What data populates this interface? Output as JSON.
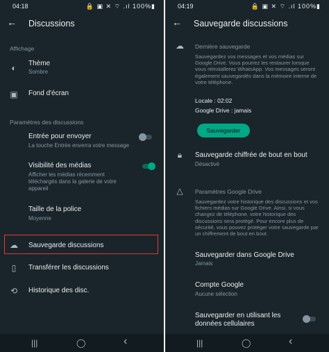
{
  "left": {
    "status": {
      "time": "04:18",
      "icons": "🔒 ▣ ✕ ⌔ .ıl 100%▮"
    },
    "title": "Discussions",
    "sections": {
      "display_head": "Affichage",
      "params_head": "Paramètres des discussions"
    },
    "items": {
      "theme": {
        "title": "Thème",
        "sub": "Sombre"
      },
      "wallpaper": {
        "title": "Fond d'écran"
      },
      "enter": {
        "title": "Entrée pour envoyer",
        "sub": "La touche Entrée enverra votre message",
        "toggle": "off"
      },
      "media": {
        "title": "Visibilité des médias",
        "sub": "Afficher les médias récemment téléchargés dans la galerie de votre appareil",
        "toggle": "on"
      },
      "font": {
        "title": "Taille de la police",
        "sub": "Moyenne"
      },
      "backup": {
        "title": "Sauvegarde discussions"
      },
      "transfer": {
        "title": "Transférer les discussions"
      },
      "history": {
        "title": "Historique des disc."
      }
    }
  },
  "right": {
    "status": {
      "time": "04:19",
      "icons": "🔒 ▣ ✕ ⌔ .ıl 100%▮"
    },
    "title": "Sauvegarde discussions",
    "last_backup": {
      "head": "Dernière sauvegarde",
      "body": "Sauvegardez vos messages et vos médias sur Google Drive. Vous pourrez les restaurer lorsque vous réinstallerez WhatsApp. Vos messages seront également sauvegardés dans la mémoire interne de votre téléphone.",
      "local": "Locale : 02:02",
      "drive": "Google Drive : jamais",
      "button": "Sauvegarder"
    },
    "encrypted": {
      "title": "Sauvegarde chiffrée de bout en bout",
      "sub": "Désactivé"
    },
    "gdrive": {
      "head": "Paramètres Google Drive",
      "body": "Sauvegardez votre historique des discussions et vos fichiers médias sur Google Drive. Ainsi, si vous changez de téléphone, votre historique des discussions sera protégé. Pour encore plus de sécurité, vous pouvez protéger votre sauvegarde par un chiffrement de bout en bout."
    },
    "save_drive": {
      "title": "Sauvegarder dans Google Drive",
      "sub": "Jamais"
    },
    "account": {
      "title": "Compte Google",
      "sub": "Aucune sélection"
    },
    "cellular": {
      "title": "Sauvegarder en utilisant les données cellulaires",
      "toggle": "off"
    }
  },
  "nav": {
    "recent": "|||",
    "home": "◯",
    "back": "‹"
  },
  "colors": {
    "accent": "#00a884",
    "background": "#1a252b",
    "highlight": "#e53935"
  }
}
